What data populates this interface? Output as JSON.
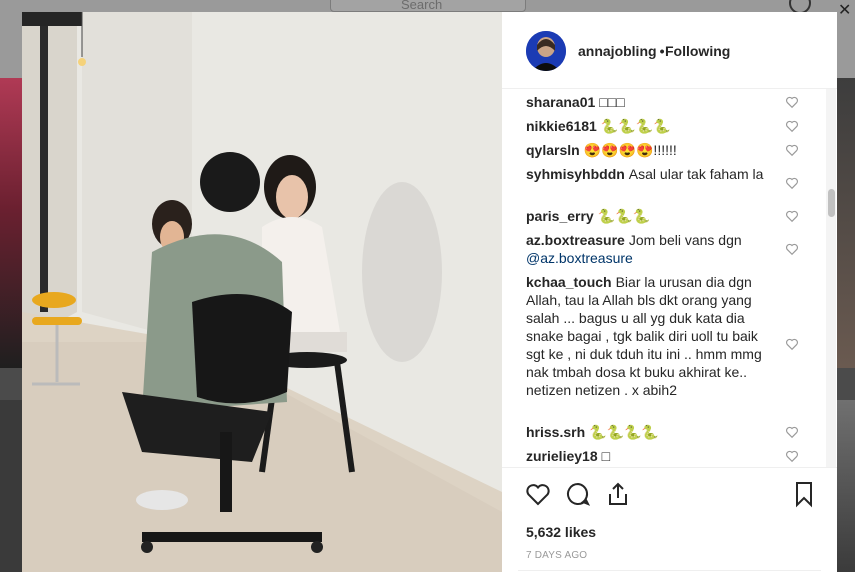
{
  "background": {
    "search_placeholder": "Search",
    "close_glyph": "✕"
  },
  "post": {
    "username": "annajobling",
    "separator": "•",
    "follow_status": "Following",
    "likes": "5,632 likes",
    "timestamp": "7 DAYS AGO"
  },
  "comments": [
    {
      "user": "sharana01",
      "text": "□□□"
    },
    {
      "user": "nikkie6181",
      "text": "🐍🐍🐍🐍"
    },
    {
      "user": "qylarsln",
      "text": "😍😍😍😍!!!!!!"
    },
    {
      "user": "syhmisyhbddn",
      "text": "Asal ular tak faham la"
    },
    {
      "user": "paris_erry",
      "text": "🐍🐍🐍"
    },
    {
      "user": "az.boxtreasure",
      "text": "Jom beli vans dgn",
      "mention": "@az.boxtreasure"
    },
    {
      "user": "kchaa_touch",
      "text": "Biar la urusan dia dgn Allah, tau la Allah bls dkt orang yang salah ... bagus u all yg duk kata dia snake bagai , tgk balik diri uoll tu baik sgt ke , ni duk tduh itu ini .. hmm mmg nak tmbah dosa kt buku akhirat ke.. netizen netizen . x abih2"
    },
    {
      "user": "hriss.srh",
      "text": "🐍🐍🐍🐍"
    },
    {
      "user": "zurieliey18",
      "text": "□"
    }
  ],
  "icons": [
    "heart-icon",
    "comment-icon",
    "share-icon",
    "bookmark-icon",
    "like-comment-heart-icon"
  ],
  "colors": {
    "text": "#262626",
    "link": "#003569",
    "muted": "#999999",
    "border": "#efefef"
  }
}
